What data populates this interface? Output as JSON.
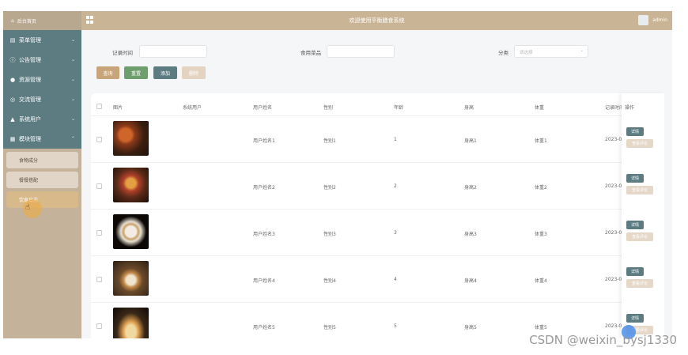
{
  "sidebar": {
    "home_label": "后台首页",
    "logo_text": "菜单管理",
    "items": [
      {
        "label": "公告管理",
        "icon": "info-icon"
      },
      {
        "label": "资源管理",
        "icon": "pin-icon"
      },
      {
        "label": "交流管理",
        "icon": "target-icon"
      },
      {
        "label": "系统用户",
        "icon": "user-icon"
      },
      {
        "label": "模块管理",
        "icon": "grid-icon"
      }
    ],
    "subitems": [
      {
        "label": "食物成分"
      },
      {
        "label": "餐餐搭配"
      },
      {
        "label": "饮食日志"
      }
    ]
  },
  "header": {
    "title": "欢迎使用平衡膳食系统",
    "user": "admin"
  },
  "filters": {
    "record_time_label": "记录时间",
    "dish_label": "食用菜品",
    "category_label": "分类",
    "category_placeholder": "请选择"
  },
  "buttons": {
    "query": "查询",
    "reset": "重置",
    "add": "添加",
    "delete": "删除"
  },
  "table": {
    "headers": [
      "图片",
      "系统用户",
      "用户姓名",
      "性别",
      "年龄",
      "身高",
      "体重",
      "记录时间",
      "操作"
    ],
    "rows": [
      {
        "name": "用户姓名1",
        "gender": "性别1",
        "age": "1",
        "height": "身高1",
        "weight": "体重1",
        "time": "2023-0"
      },
      {
        "name": "用户姓名2",
        "gender": "性别2",
        "age": "2",
        "height": "身高2",
        "weight": "体重2",
        "time": "2023-0"
      },
      {
        "name": "用户姓名3",
        "gender": "性别3",
        "age": "3",
        "height": "身高3",
        "weight": "体重3",
        "time": "2023-0"
      },
      {
        "name": "用户姓名4",
        "gender": "性别4",
        "age": "4",
        "height": "身高4",
        "weight": "体重4",
        "time": "2023-0"
      },
      {
        "name": "用户姓名5",
        "gender": "性别5",
        "age": "5",
        "height": "身高5",
        "weight": "体重5",
        "time": "2023-0"
      }
    ],
    "detail_label": "详情",
    "eval_label": "查看评论"
  },
  "watermark": "CSDN @weixin_bysj1330",
  "colors": {
    "sidebar": "#c4b39a",
    "menu": "#5c7c82",
    "header": "#c9b596",
    "query_btn": "#c7a47a",
    "reset_btn": "#6e9e6c",
    "add_btn": "#5c7c82",
    "delete_btn": "#e3d3c0"
  }
}
